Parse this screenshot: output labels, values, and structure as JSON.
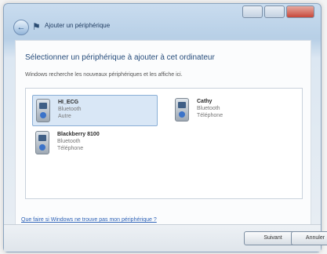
{
  "window": {
    "title": "Ajouter un périphérique",
    "back_icon": "back-arrow-icon",
    "device_icon": "add-device-icon",
    "controls": [
      "minimize",
      "maximize",
      "close"
    ]
  },
  "main": {
    "heading": "Sélectionner un périphérique à ajouter à cet ordinateur",
    "subtext": "Windows recherche les nouveaux périphériques et les affiche ici.",
    "devices": [
      {
        "name": "HI_ECG",
        "type": "Bluetooth",
        "category": "Autre",
        "selected": true
      },
      {
        "name": "Cathy",
        "type": "Bluetooth",
        "category": "Téléphone",
        "selected": false
      },
      {
        "name": "Blackberry 8100",
        "type": "Bluetooth",
        "category": "Téléphone",
        "selected": false
      }
    ],
    "help_link": "Que faire si Windows ne trouve pas mon périphérique ?"
  },
  "footer": {
    "next_label": "Suivant",
    "cancel_label": "Annuler"
  },
  "colors": {
    "accent": "#274d7c",
    "selection": "#d9e7f6",
    "link": "#2f63b7"
  }
}
